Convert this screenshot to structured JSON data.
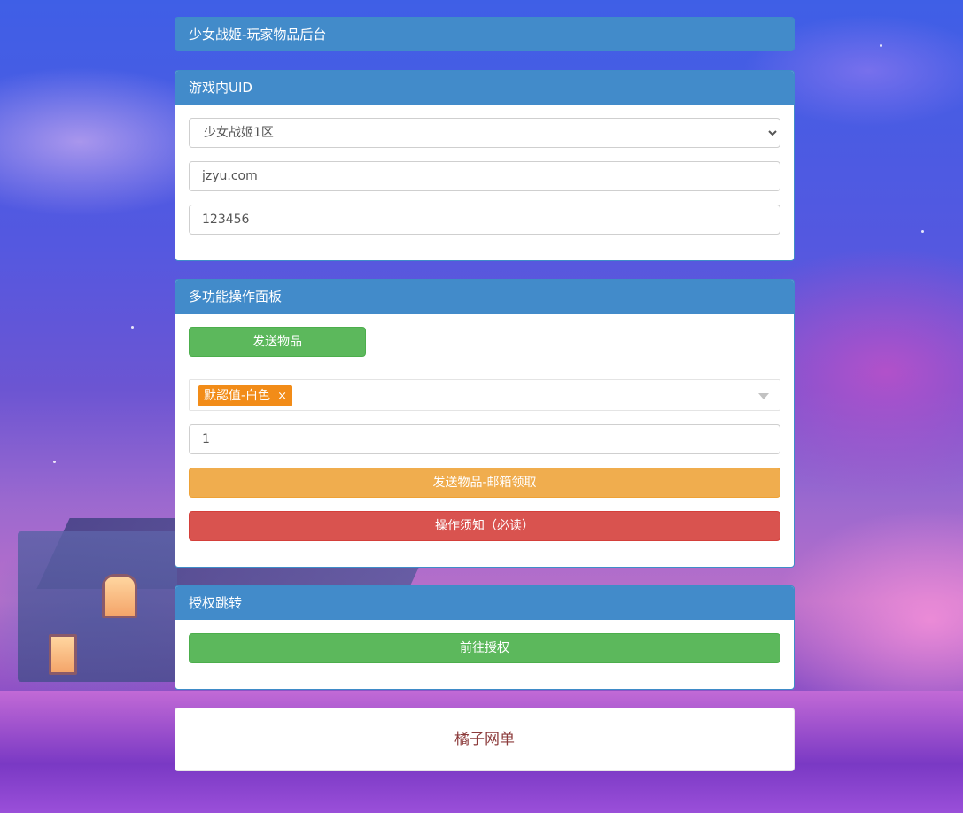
{
  "header": {
    "title": "少女战姬-玩家物品后台"
  },
  "uid_panel": {
    "title": "游戏内UID",
    "server_select": {
      "value": "少女战姬1区",
      "options": [
        "少女战姬1区"
      ]
    },
    "account_input": {
      "value": "jzyu.com"
    },
    "password_input": {
      "value": "123456"
    }
  },
  "ops_panel": {
    "title": "多功能操作面板",
    "send_item_button": "发送物品",
    "item_tag": {
      "label": "默認值-白色",
      "close": "×"
    },
    "quantity_input": {
      "value": "1"
    },
    "mail_send_button": "发送物品-邮箱领取",
    "notice_button": "操作须知（必读）"
  },
  "auth_panel": {
    "title": "授权跳转",
    "goto_auth_button": "前往授权"
  },
  "footer": {
    "text": "橘子网单"
  },
  "colors": {
    "panel_heading": "#428bca",
    "success": "#5cb85c",
    "warning": "#f0ad4e",
    "danger": "#d9534f",
    "tag": "#f28c18",
    "footer_text": "#8b3a3a"
  }
}
